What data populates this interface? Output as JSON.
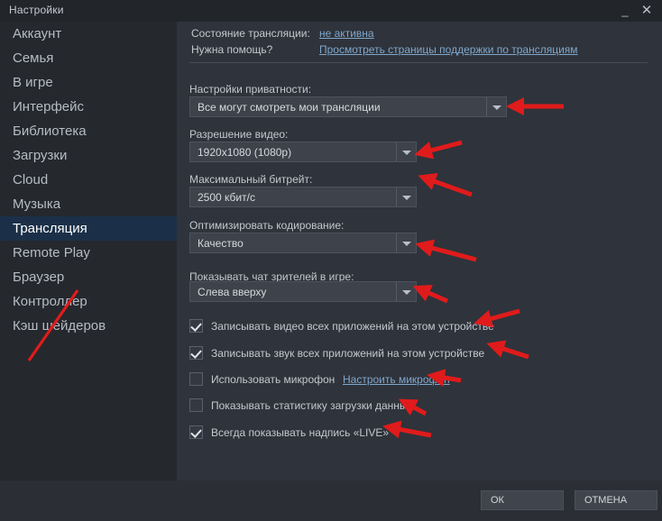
{
  "window": {
    "title": "Настройки",
    "minimize_icon": "minimize-icon",
    "minimize_glyph": "_",
    "close_icon": "close-icon",
    "close_glyph": "✕"
  },
  "sidebar": {
    "items": [
      {
        "label": "Аккаунт",
        "selected": false
      },
      {
        "label": "Семья",
        "selected": false
      },
      {
        "label": "В игре",
        "selected": false
      },
      {
        "label": "Интерфейс",
        "selected": false
      },
      {
        "label": "Библиотека",
        "selected": false
      },
      {
        "label": "Загрузки",
        "selected": false
      },
      {
        "label": "Cloud",
        "selected": false
      },
      {
        "label": "Музыка",
        "selected": false
      },
      {
        "label": "Трансляция",
        "selected": true
      },
      {
        "label": "Remote Play",
        "selected": false
      },
      {
        "label": "Браузер",
        "selected": false
      },
      {
        "label": "Контроллер",
        "selected": false
      },
      {
        "label": "Кэш шейдеров",
        "selected": false
      }
    ]
  },
  "main": {
    "status_label": "Состояние трансляции:",
    "status_value": "не активна",
    "help_label": "Нужна помощь?",
    "help_link": "Просмотреть страницы поддержки по трансляциям",
    "fields": [
      {
        "label": "Настройки приватности:",
        "value": "Все могут смотреть мои трансляции"
      },
      {
        "label": "Разрешение видео:",
        "value": "1920x1080 (1080p)"
      },
      {
        "label": "Максимальный битрейт:",
        "value": "2500 кбит/с"
      },
      {
        "label": "Оптимизировать кодирование:",
        "value": "Качество"
      },
      {
        "label": "Показывать чат зрителей в игре:",
        "value": "Слева вверху"
      }
    ],
    "checkboxes": [
      {
        "label": "Записывать видео всех приложений на этом устройстве",
        "checked": true,
        "link": ""
      },
      {
        "label": "Записывать звук всех приложений на этом устройстве",
        "checked": true,
        "link": ""
      },
      {
        "label": "Использовать микрофон",
        "checked": false,
        "link": "Настроить микрофон"
      },
      {
        "label": "Показывать статистику загрузки данных",
        "checked": false,
        "link": ""
      },
      {
        "label": "Всегда показывать надпись «LIVE»",
        "checked": true,
        "link": ""
      }
    ]
  },
  "footer": {
    "ok_label": "ОК",
    "cancel_label": "ОТМЕНА"
  },
  "colors": {
    "accent_selected": "#1b3048",
    "link": "#7fa7cc",
    "annotation_arrow": "#e01b1b",
    "panel_bg": "#2f333b",
    "sidebar_bg": "#25282d"
  },
  "annotations": {
    "type": "red-arrows",
    "count": 11
  }
}
